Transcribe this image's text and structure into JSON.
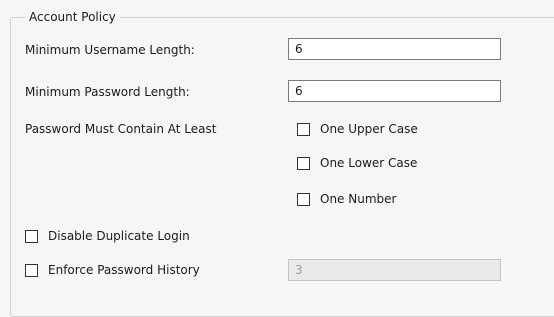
{
  "group": {
    "title": "Account Policy"
  },
  "min_username": {
    "label": "Minimum Username Length:",
    "value": "6"
  },
  "min_password": {
    "label": "Minimum Password Length:",
    "value": "6"
  },
  "contain": {
    "label": "Password Must Contain At Least",
    "options": [
      {
        "label": "One Upper Case",
        "checked": false
      },
      {
        "label": "One Lower Case",
        "checked": false
      },
      {
        "label": "One Number",
        "checked": false
      }
    ]
  },
  "disable_duplicate_login": {
    "label": "Disable Duplicate Login",
    "checked": false
  },
  "password_history": {
    "label": "Enforce Password History",
    "checked": false,
    "value": "3",
    "enabled": false
  }
}
